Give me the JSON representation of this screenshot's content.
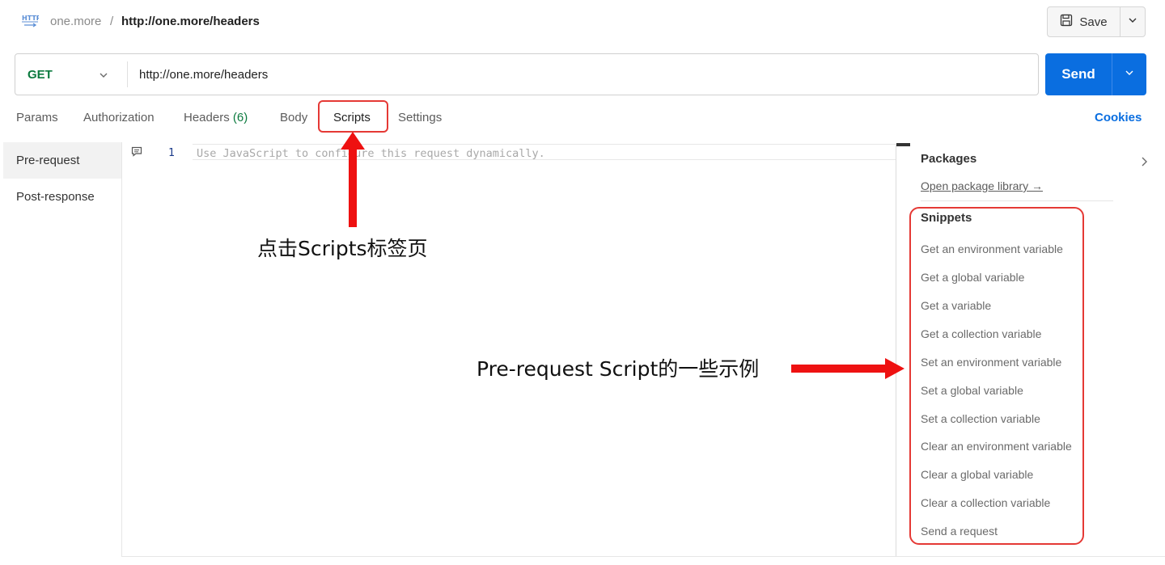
{
  "breadcrumb": {
    "icon": "http-icon",
    "parent": "one.more",
    "separator": "/",
    "current": "http://one.more/headers"
  },
  "toolbar": {
    "save_label": "Save"
  },
  "request": {
    "method": "GET",
    "url": "http://one.more/headers",
    "send_label": "Send"
  },
  "tabs": {
    "params": "Params",
    "authorization": "Authorization",
    "headers": "Headers",
    "headers_count": "(6)",
    "body": "Body",
    "scripts": "Scripts",
    "settings": "Settings",
    "cookies": "Cookies",
    "active": "Scripts"
  },
  "script_tabs": {
    "pre_request": "Pre-request",
    "post_response": "Post-response",
    "active": "Pre-request"
  },
  "editor": {
    "line_number": "1",
    "placeholder": "Use JavaScript to configure this request dynamically."
  },
  "side_panel": {
    "packages_title": "Packages",
    "open_library": "Open package library →",
    "snippets_title": "Snippets",
    "snippets": [
      "Get an environment variable",
      "Get a global variable",
      "Get a variable",
      "Get a collection variable",
      "Set an environment variable",
      "Set a global variable",
      "Set a collection variable",
      "Clear an environment variable",
      "Clear a global variable",
      "Clear a collection variable",
      "Send a request"
    ]
  },
  "annotations": {
    "scripts_tab_note": "点击Scripts标签页",
    "snippets_note": "Pre-request Script的一些示例"
  },
  "colors": {
    "accent_blue": "#0a6ee0",
    "method_green": "#0b7a3e",
    "annotation_red": "#e53935"
  }
}
